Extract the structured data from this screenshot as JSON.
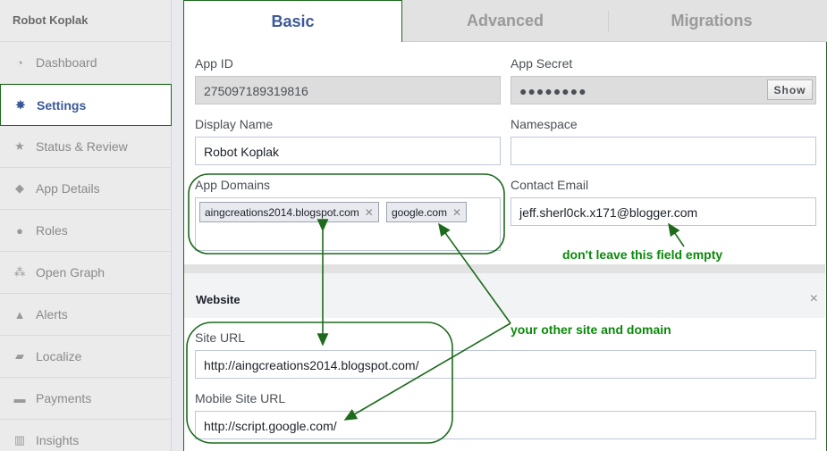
{
  "sidebar": {
    "app_name": "Robot Koplak",
    "items": [
      {
        "label": "Dashboard",
        "icon": "dashboard-icon"
      },
      {
        "label": "Settings",
        "icon": "gear-icon",
        "active": true
      },
      {
        "label": "Status & Review",
        "icon": "star-icon"
      },
      {
        "label": "App Details",
        "icon": "cube-icon"
      },
      {
        "label": "Roles",
        "icon": "person-icon"
      },
      {
        "label": "Open Graph",
        "icon": "graph-icon"
      },
      {
        "label": "Alerts",
        "icon": "warning-icon"
      },
      {
        "label": "Localize",
        "icon": "map-icon"
      },
      {
        "label": "Payments",
        "icon": "card-icon"
      },
      {
        "label": "Insights",
        "icon": "chart-icon"
      }
    ]
  },
  "tabs": [
    {
      "label": "Basic",
      "active": true
    },
    {
      "label": "Advanced"
    },
    {
      "label": "Migrations"
    }
  ],
  "form": {
    "app_id_label": "App ID",
    "app_id_value": "275097189319816",
    "app_secret_label": "App Secret",
    "app_secret_value": "●●●●●●●●",
    "show_label": "Show",
    "display_name_label": "Display Name",
    "display_name_value": "Robot Koplak",
    "namespace_label": "Namespace",
    "namespace_value": "",
    "app_domains_label": "App Domains",
    "app_domains": [
      "aingcreations2014.blogspot.com",
      "google.com"
    ],
    "contact_email_label": "Contact Email",
    "contact_email_value": "jeff.sherl0ck.x171@blogger.com"
  },
  "website": {
    "title": "Website",
    "close": "×",
    "site_url_label": "Site URL",
    "site_url_value": "http://aingcreations2014.blogspot.com/",
    "mobile_url_label": "Mobile Site URL",
    "mobile_url_value": "http://script.google.com/"
  },
  "annotations": {
    "email_note": "don't leave this field empty",
    "domain_note": "your other site and domain"
  },
  "colors": {
    "annotation_green": "#0a8a0a",
    "outline_green": "#1d6a1d",
    "facebook_blue": "#3b5998"
  }
}
